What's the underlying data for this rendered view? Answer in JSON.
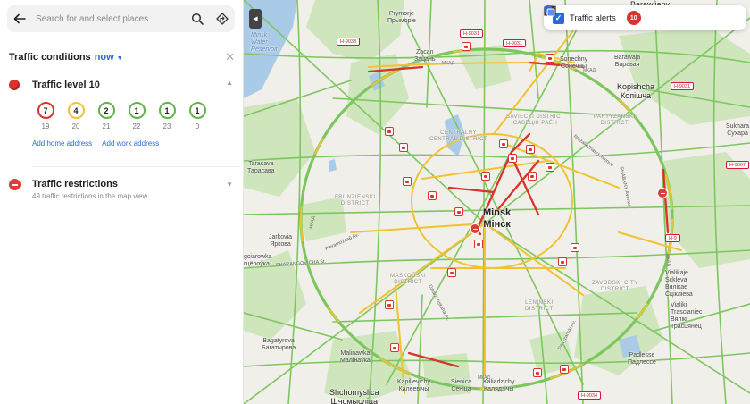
{
  "search": {
    "placeholder": "Search for and select places"
  },
  "traffic": {
    "title": "Traffic conditions",
    "now_label": "now",
    "level_label": "Traffic level 10",
    "forecast": [
      {
        "level": "7",
        "hour": "19",
        "color": "#d9332b"
      },
      {
        "level": "4",
        "hour": "20",
        "color": "#f1c232"
      },
      {
        "level": "2",
        "hour": "21",
        "color": "#62b34c"
      },
      {
        "level": "1",
        "hour": "22",
        "color": "#62b34c"
      },
      {
        "level": "1",
        "hour": "23",
        "color": "#62b34c"
      },
      {
        "level": "1",
        "hour": "0",
        "color": "#62b34c"
      }
    ],
    "add_home": "Add home address",
    "add_work": "Add work address"
  },
  "restrictions": {
    "title": "Traffic restrictions",
    "subtitle": "49 traffic restrictions in the map view"
  },
  "toolbar": {
    "alerts_label": "Traffic alerts",
    "alerts_count": "10"
  },
  "map": {
    "places": {
      "barawliany": "Barawliany",
      "prymorje": "Prymorje\nПрымор'е",
      "zacan": "Zacan\nЗацань",
      "sonechny": "Sonechny\nСонечны",
      "barawaja": "Barawaja\nВаравая",
      "kopishcha": "Kopishcha\nКопішча",
      "tarasava": "Tarasava\nТарасава",
      "minsk": "Minsk\nМінск",
      "jarkovia": "Jarkovia\nЯркова",
      "gciarowka": "gciarowka\nгцёроўка",
      "vialikaje": "Vialikaje\nSćkleva\nВялікае\nСцікліева",
      "trascianiec": "Vialiki\nTrascianiec\nВялікі\nТрасцянец",
      "bagatyrova": "Bagatyrova\nБагатырова",
      "malinawka": "Malinawka\nМалінаўка",
      "padlesse": "Padlesse\nПадлессе",
      "shchomyslica": "Shchomyslica\nШчомысліца",
      "kapiljevichy": "Kapiljevichy\nКалеевічы",
      "sienica": "Sienica\nСеніца",
      "kaliadzichy": "Kaliadzichy\nКалядзічы",
      "sukhara": "Sukhara\nСухара",
      "water": "Minsk\nWater\nReservoir"
    },
    "districts": {
      "central": "CENTRALNY\nCENTRAL DISTRICT",
      "savetski": "SAVIECKI DISTRICT\nСАВЕЦКІ РАЁН",
      "frunzenski": "FRUNZIENSKI\nDISTRICT",
      "maskouski": "MASKOŬSKI\nDISTRICT",
      "partyzanski": "PARTYZANSKI\nDISTRICT",
      "zavadski": "ZAVODSKI CITY\nDISTRICT",
      "leninski": "LENINSKI\nDISTRICT"
    },
    "streets": {
      "pieramozhcau": "Pieramožcaŭ Av.",
      "dziarzhynskaha": "Dziaržynskaha Av.",
      "shabany": "SHABANY Avenue",
      "partyzanski_av": "Partyzanski Av.",
      "niezalezhnasci": "Niezaliežnasci Avenue",
      "haranska": "SHARANGOVICHA St."
    },
    "shields": {
      "h9038": "H-9038",
      "h9031a": "H-9031",
      "h9031b": "H-9031",
      "h9031c": "H-9031",
      "h9067": "H-9067",
      "h9034": "H-9034",
      "h9": "H-9",
      "mkad_n": "МКАД",
      "mkad_ne": "МКАД",
      "mkad_w": "МКАД",
      "mkad_s": "МКАД",
      "mkad_e": "МКАД"
    }
  },
  "colors": {
    "jam_red": "#d9332b",
    "slow_yellow": "#f1c232",
    "free_green": "#62b34c",
    "accent_blue": "#2a6ad8"
  }
}
